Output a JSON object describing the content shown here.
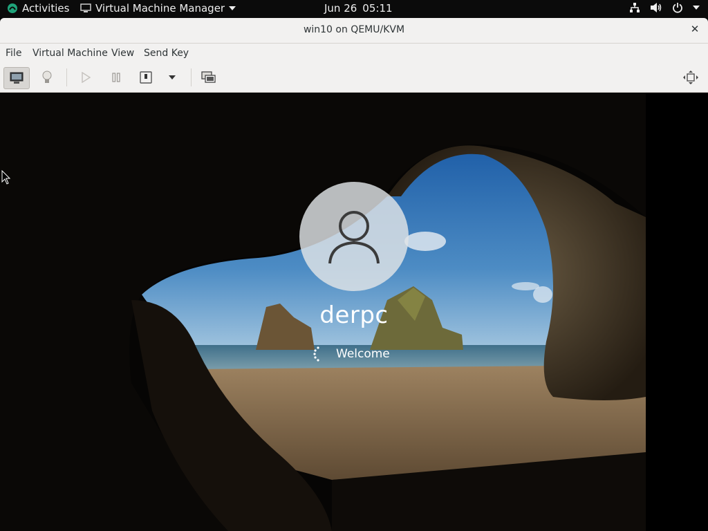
{
  "topbar": {
    "activities": "Activities",
    "app_name": "Virtual Machine Manager",
    "date": "Jun 26",
    "time": "05:11"
  },
  "window": {
    "title": "win10 on QEMU/KVM",
    "close_glyph": "✕"
  },
  "menubar": {
    "items": [
      "File",
      "Virtual Machine",
      "View",
      "Send Key"
    ]
  },
  "toolbar": {
    "buttons": [
      "console-monitor-icon",
      "details-lightbulb-icon",
      "run-icon",
      "pause-icon",
      "shutdown-icon",
      "shutdown-menu-icon",
      "snapshots-icon",
      "fullscreen-icon"
    ]
  },
  "vm": {
    "username": "derpc",
    "status": "Welcome"
  }
}
